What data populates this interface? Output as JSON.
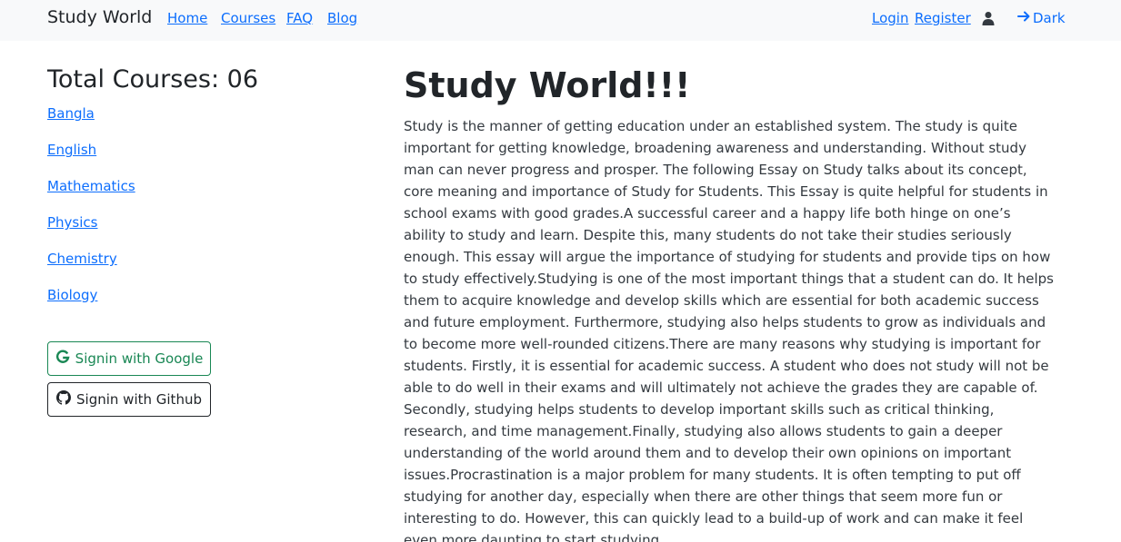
{
  "navbar": {
    "brand": "Study World",
    "links": {
      "home": "Home",
      "courses": "Courses",
      "faq": "FAQ",
      "blog": "Blog"
    },
    "login": "Login",
    "register": "Register",
    "user_icon": "user-icon",
    "theme_icon": "arrow-right-icon",
    "theme_label": "Dark"
  },
  "sidebar": {
    "title": "Total Courses: 06",
    "courses": [
      "Bangla",
      "English",
      "Mathematics",
      "Physics",
      "Chemistry",
      "Biology"
    ],
    "google_label": "Signin with Google",
    "github_label": "Signin with Github"
  },
  "main": {
    "title": "Study World!!!",
    "body": "Study is the manner of getting education under an established system. The study is quite important for getting knowledge, broadening awareness and understanding. Without study man can never progress and prosper. The following Essay on Study talks about its concept, core meaning and importance of Study for Students. This Essay is quite helpful for students in school exams with good grades.A successful career and a happy life both hinge on one’s ability to study and learn. Despite this, many students do not take their studies seriously enough. This essay will argue the importance of studying for students and provide tips on how to study effectively.Studying is one of the most important things that a student can do. It helps them to acquire knowledge and develop skills which are essential for both academic success and future employment. Furthermore, studying also helps students to grow as individuals and to become more well-rounded citizens.There are many reasons why studying is important for students. Firstly, it is essential for academic success. A student who does not study will not be able to do well in their exams and will ultimately not achieve the grades they are capable of. Secondly, studying helps students to develop important skills such as critical thinking, research, and time management.Finally, studying also allows students to gain a deeper understanding of the world around them and to develop their own opinions on important issues.Procrastination is a major problem for many students. It is often tempting to put off studying for another day, especially when there are other things that seem more fun or interesting to do. However, this can quickly lead to a build-up of work and can make it feel even more daunting to start studying."
  },
  "colors": {
    "link": "#0d6efd",
    "navbar_bg": "#f8f9fa",
    "google": "#198754",
    "text": "#212529"
  }
}
